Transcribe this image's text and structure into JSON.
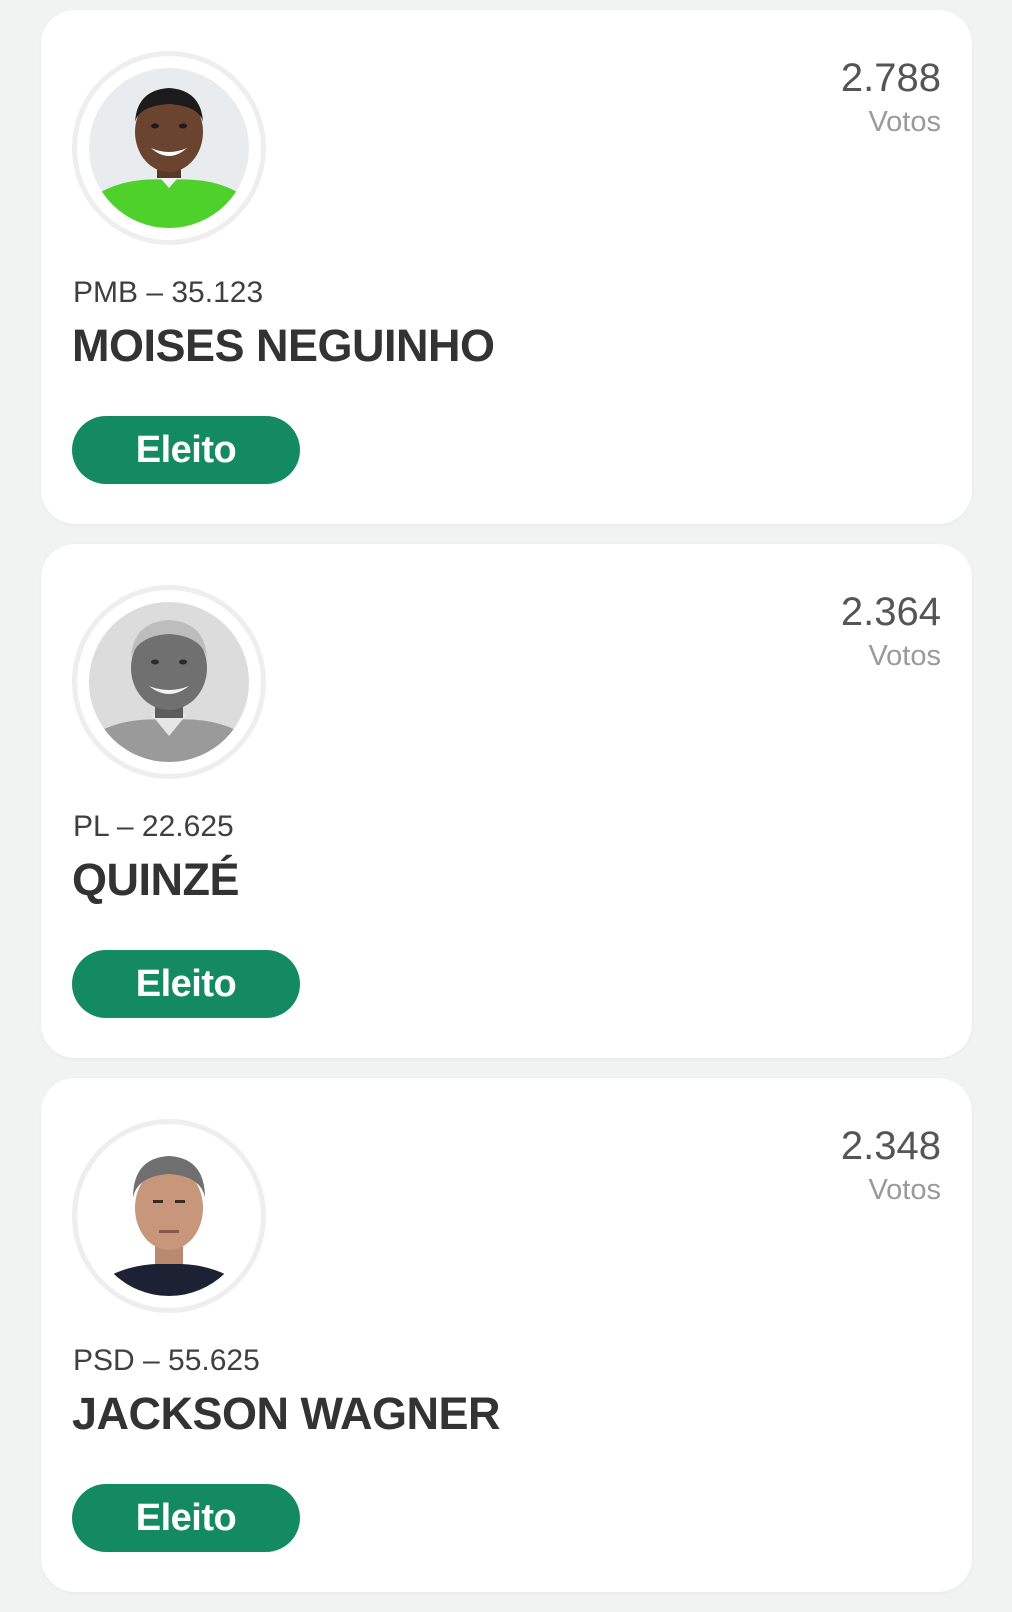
{
  "candidates": [
    {
      "party": "PMB – 35.123",
      "name": "MOISES NEGUINHO",
      "votes": "2.788",
      "votes_label": "Votos",
      "status": "Eleito",
      "photo": "candidate-photo-green-shirt"
    },
    {
      "party": "PL – 22.625",
      "name": "QUINZÉ",
      "votes": "2.364",
      "votes_label": "Votos",
      "status": "Eleito",
      "photo": "candidate-photo-grayscale"
    },
    {
      "party": "PSD – 55.625",
      "name": "JACKSON WAGNER",
      "votes": "2.348",
      "votes_label": "Votos",
      "status": "Eleito",
      "photo": "candidate-photo-dark-shirt"
    }
  ],
  "colors": {
    "badge": "#148a63",
    "background": "#f1f2f2",
    "card": "#ffffff"
  }
}
